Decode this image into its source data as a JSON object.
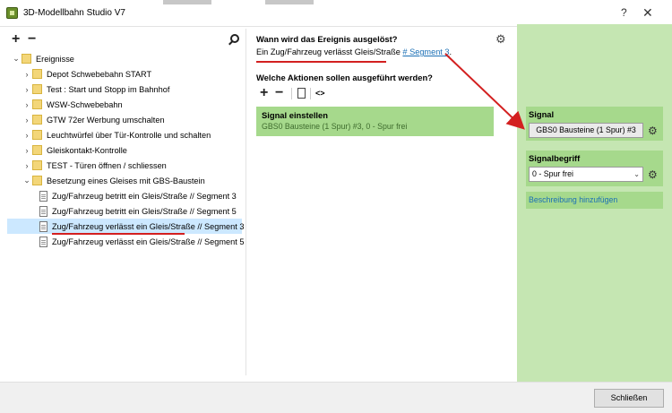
{
  "window": {
    "title": "3D-Modellbahn Studio V7",
    "help_label": "?",
    "close_label": "✕"
  },
  "tree_toolbar": {
    "add_label": "+",
    "remove_label": "−"
  },
  "tree": [
    {
      "label": "Ereignisse",
      "type": "folder",
      "level": 0,
      "expanded": true
    },
    {
      "label": "Depot Schwebebahn START",
      "type": "folder",
      "level": 1,
      "expanded": false
    },
    {
      "label": "Test : Start und Stopp im Bahnhof",
      "type": "folder",
      "level": 1,
      "expanded": false
    },
    {
      "label": "WSW-Schwebebahn",
      "type": "folder",
      "level": 1,
      "expanded": false
    },
    {
      "label": "GTW 72er Werbung umschalten",
      "type": "folder",
      "level": 1,
      "expanded": false
    },
    {
      "label": "Leuchtwürfel über Tür-Kontrolle und schalten",
      "type": "folder",
      "level": 1,
      "expanded": false
    },
    {
      "label": "Gleiskontakt-Kontrolle",
      "type": "folder",
      "level": 1,
      "expanded": false
    },
    {
      "label": "TEST - Türen öffnen / schliessen",
      "type": "folder",
      "level": 1,
      "expanded": false
    },
    {
      "label": "Besetzung eines Gleises mit GBS-Baustein",
      "type": "folder",
      "level": 1,
      "expanded": true
    },
    {
      "label": "Zug/Fahrzeug betritt ein Gleis/Straße // Segment 3",
      "type": "doc",
      "level": 2
    },
    {
      "label": "Zug/Fahrzeug betritt ein Gleis/Straße // Segment 5",
      "type": "doc",
      "level": 2
    },
    {
      "label": "Zug/Fahrzeug verlässt ein Gleis/Straße // Segment 3",
      "type": "doc",
      "level": 2,
      "selected": true
    },
    {
      "label": "Zug/Fahrzeug verlässt ein Gleis/Straße // Segment 5",
      "type": "doc",
      "level": 2
    }
  ],
  "trigger": {
    "heading": "Wann wird das Ereignis ausgelöst?",
    "text": "Ein Zug/Fahrzeug verlässt Gleis/Straße",
    "link": "# Segment 3",
    "suffix": "."
  },
  "actions": {
    "heading": "Welche Aktionen sollen ausgeführt werden?",
    "toolbar": {
      "add_label": "+",
      "remove_label": "−",
      "code_label": "<>"
    },
    "items": [
      {
        "title": "Signal einstellen",
        "subtitle": "GBS0 Bausteine (1 Spur) #3, 0 - Spur frei"
      }
    ]
  },
  "properties": {
    "signal_label": "Signal",
    "signal_value": "GBS0 Bausteine (1 Spur) #3",
    "signalbegriff_label": "Signalbegriff",
    "signalbegriff_value": "0 - Spur frei",
    "description_link": "Beschreibung hinzufügen"
  },
  "footer": {
    "close_button": "Schließen"
  },
  "colors": {
    "panel_green": "#c5e6b2",
    "card_green": "#a6d98c",
    "selection_blue": "#cce8ff",
    "link_blue": "#1a6fb5",
    "annotation_red": "#d32020"
  }
}
